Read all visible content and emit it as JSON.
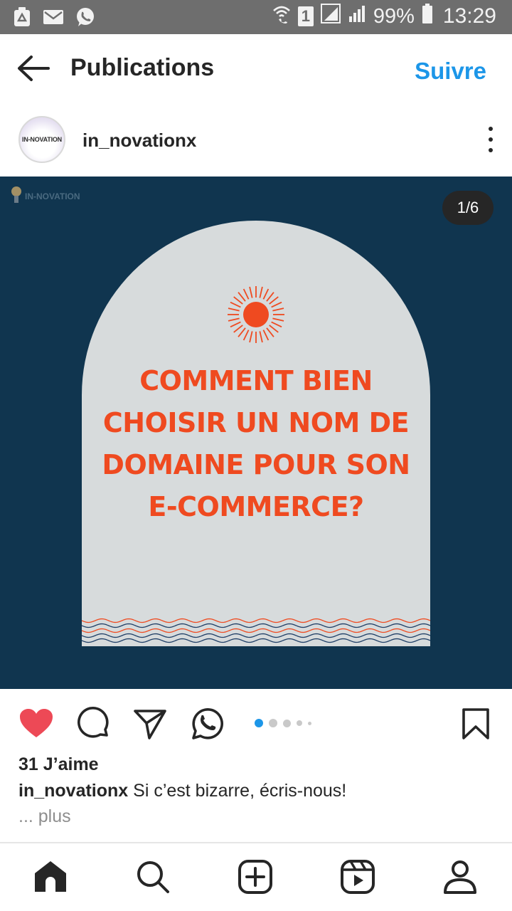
{
  "status_bar": {
    "left_icons": [
      "recycle-icon",
      "mail-icon",
      "whatsapp-icon"
    ],
    "right_icons": [
      "wifi-call-icon",
      "sim-1-icon",
      "signal-icon",
      "signal-icon",
      "battery-icon"
    ],
    "sim_label": "1",
    "battery": "99%",
    "time": "13:29"
  },
  "header": {
    "title": "Publications",
    "follow_label": "Suivre"
  },
  "post": {
    "author": "in_novationx",
    "avatar_text": "IN-NOVATION",
    "brand_mark": "IN-NOVATION",
    "counter": "1/6",
    "headline_lines": [
      "COMMENT BIEN",
      "CHOISIR UN NOM DE",
      "DOMAINE POUR SON",
      "E-COMMERCE?"
    ],
    "carousel_total": 5,
    "carousel_active": 1,
    "likes": "31 J’aime",
    "caption_user": "in_novationx",
    "caption_text": "Si c’est bizarre, écris-nous!",
    "more_label": "... plus"
  },
  "colors": {
    "accent_blue": "#1c96e8",
    "heart_red": "#ed4956",
    "image_bg": "#10354f",
    "arch": "#d7dbdc",
    "headline_orange": "#ef4a20"
  },
  "bottom_nav": [
    "home-icon",
    "search-icon",
    "new-post-icon",
    "reels-icon",
    "profile-icon"
  ]
}
